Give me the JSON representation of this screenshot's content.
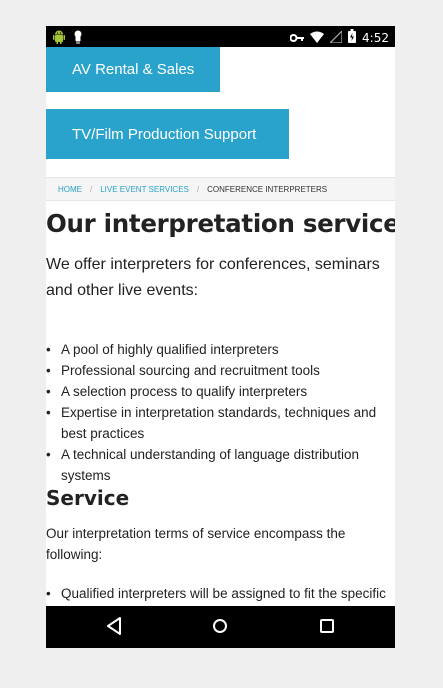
{
  "status_bar": {
    "time": "4:52",
    "left_icons": [
      "android-icon",
      "notification-icon"
    ],
    "right_icons": [
      "key-icon",
      "wifi-icon",
      "signal-icon",
      "battery-icon"
    ]
  },
  "nav": {
    "rental_label": "AV Rental & Sales",
    "tvfilm_label": "TV/Film Production Support",
    "accent": "#29a3cc"
  },
  "breadcrumb": {
    "home": "HOME",
    "live_events": "LIVE EVENT SERVICES",
    "current": "CONFERENCE INTERPRETERS"
  },
  "page": {
    "title": "Our interpretation services",
    "intro": "We offer interpreters for conferences, seminars and other live events:",
    "features": [
      "A pool of highly qualified interpreters",
      "Professional sourcing and recruitment tools",
      "A selection process to qualify interpreters",
      "Expertise in interpretation standards, techniques and best practices",
      "A technical understanding of language distribution systems"
    ],
    "service_heading": "Service",
    "service_intro": "Our interpretation terms of service encompass the following:",
    "terms": [
      "Qualified interpreters will be assigned to fit the specific"
    ]
  },
  "android_nav": {
    "icons": [
      "back-icon",
      "home-icon",
      "recents-icon"
    ]
  }
}
